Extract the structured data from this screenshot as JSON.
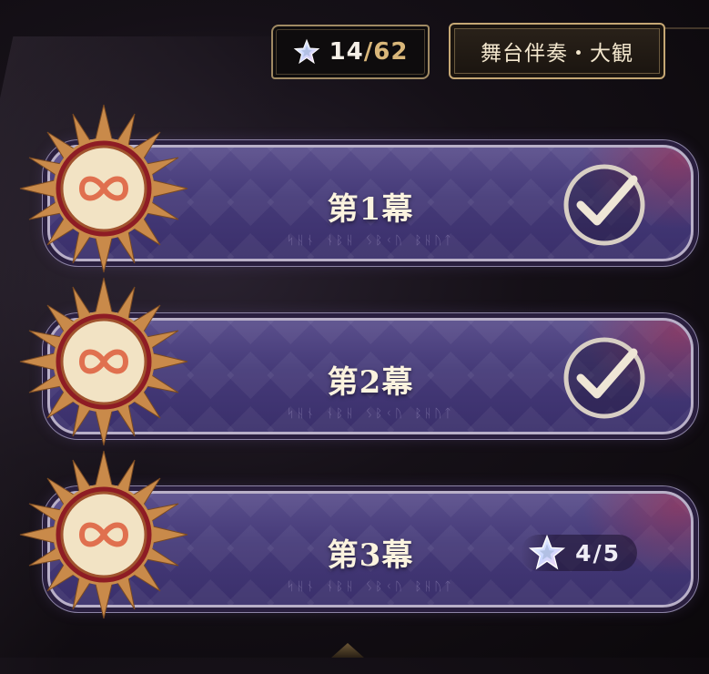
{
  "hud": {
    "stars_current": "14",
    "stars_separator": "/",
    "stars_total": "62",
    "star_icon": "star-icon",
    "stage_title": "舞台伴奏・大観"
  },
  "acts": [
    {
      "title": "第1幕",
      "subtitle": "ᛋᚺᚾ ᚾᛒᚺ ᛊᛒᚲᚢ ᛒᚺᚢᛏ",
      "status": "completed",
      "status_icon": "checkmark-icon"
    },
    {
      "title": "第2幕",
      "subtitle": "ᛋᚺᚾ ᚾᛒᚺ ᛊᛒᚲᚢ ᛒᚺᚢᛏ",
      "status": "completed",
      "status_icon": "checkmark-icon"
    },
    {
      "title": "第3幕",
      "subtitle": "ᛋᚺᚾ ᚾᛒᚺ ᛊᛒᚲᚢ ᛒᚺᚢᛏ",
      "status": "in-progress",
      "stars": "4/5",
      "status_icon": "star-icon"
    }
  ],
  "colors": {
    "plate": "#453a78",
    "gold": "#d9b77a",
    "emblem_red": "#8e1c24",
    "emblem_cream": "#f2e3c4"
  }
}
